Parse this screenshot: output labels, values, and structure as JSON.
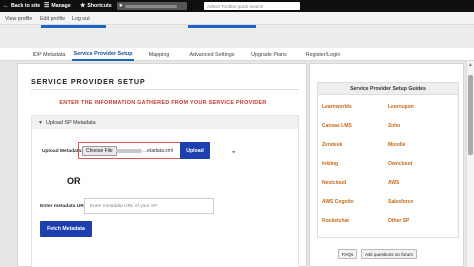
{
  "toolbar": {
    "back_label": "Back to site",
    "manage_label": "Manage",
    "shortcuts_label": "Shortcuts",
    "search_placeholder": "Admin Toolbar quick search"
  },
  "subbar": {
    "links": [
      "View profile",
      "Edit profile",
      "Log out"
    ]
  },
  "tabs": [
    {
      "label": "IDP Metadata",
      "active": false
    },
    {
      "label": "Service Provider Setup",
      "active": true
    },
    {
      "label": "Mapping",
      "active": false
    },
    {
      "label": "Advanced Settings",
      "active": false
    },
    {
      "label": "Upgrade Plans",
      "active": false
    },
    {
      "label": "Register/Login",
      "active": false
    }
  ],
  "main": {
    "title": "SERVICE PROVIDER SETUP",
    "instruction": "ENTER THE INFORMATION GATHERED FROM YOUR SERVICE PROVIDER",
    "upload_section": {
      "heading": "Upload SP Metadata",
      "upload_metadata_label": "Upload Metadata:",
      "choose_file_label": "Choose File",
      "file_name_suffix": "...etadata.xml",
      "upload_button": "Upload",
      "or_label": "OR",
      "metadata_url_label": "Enter metadata URL:",
      "metadata_url_placeholder": "Enter metadata URL of your SP.",
      "fetch_button": "Fetch Metadata"
    }
  },
  "guides": {
    "title": "Service Provider Setup Guides",
    "left": [
      "Learnworlds",
      "Canvas LMS",
      "Zendesk",
      "Inkling",
      "Nextcloud",
      "AWS Cognito",
      "Rocketchat"
    ],
    "right": [
      "Learnupon",
      "Zoho",
      "Moodle",
      "Owncloud",
      "AWS",
      "Salesforce",
      "Other SP"
    ],
    "faq_button": "FAQs",
    "ask_button": "Ask questions on forum"
  },
  "colors": {
    "primary_button": "#1e3fae",
    "link_orange": "#c4691b",
    "instruction_red": "#c0392b",
    "active_tab": "#1e67c1"
  }
}
